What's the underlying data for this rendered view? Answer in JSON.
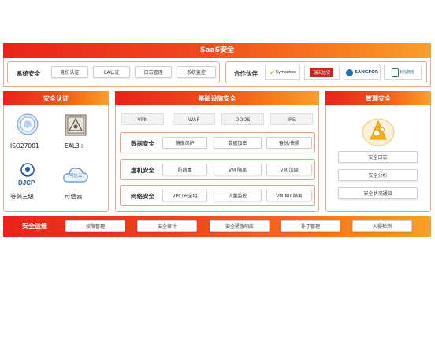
{
  "saas": {
    "title": "SaaS安全"
  },
  "system_security": {
    "label": "系统安全",
    "items": [
      "身份认证",
      "CA认证",
      "日志管理",
      "系统监控"
    ]
  },
  "partners": {
    "label": "合作伙伴",
    "logos": [
      "Symantec",
      "瑞天信安",
      "SANGFOR",
      "科技网络"
    ]
  },
  "auth": {
    "title": "安全认证",
    "certs": [
      {
        "name": "ISO27001",
        "icon": "iso-seal-icon"
      },
      {
        "name": "EAL3+",
        "icon": "eal-badge-icon"
      },
      {
        "name": "等保三级",
        "icon": "djcp-icon"
      },
      {
        "name": "可信云",
        "icon": "trusted-cloud-icon"
      }
    ],
    "djcp_text": "DJCP",
    "cloud_text": "可信云"
  },
  "infra": {
    "title": "基础设施安全",
    "top": [
      "VPN",
      "WAF",
      "DDOS",
      "IPS"
    ],
    "rows": [
      {
        "label": "数据安全",
        "items": [
          "镜像保护",
          "数据加密",
          "备份/快照"
        ]
      },
      {
        "label": "虚机安全",
        "items": [
          "防病毒",
          "VM 隔离",
          "VM 加固"
        ]
      },
      {
        "label": "网络安全",
        "items": [
          "VPC/安全组",
          "流量监控",
          "VM NIC隔离"
        ]
      }
    ]
  },
  "mgmt": {
    "title": "管理安全",
    "items": [
      "安全日志",
      "安全分析",
      "安全状况通知"
    ]
  },
  "ops": {
    "title": "安全运维",
    "items": [
      "权限管理",
      "安全审计",
      "安全紧急响应",
      "补丁管理",
      "入侵检测"
    ]
  }
}
